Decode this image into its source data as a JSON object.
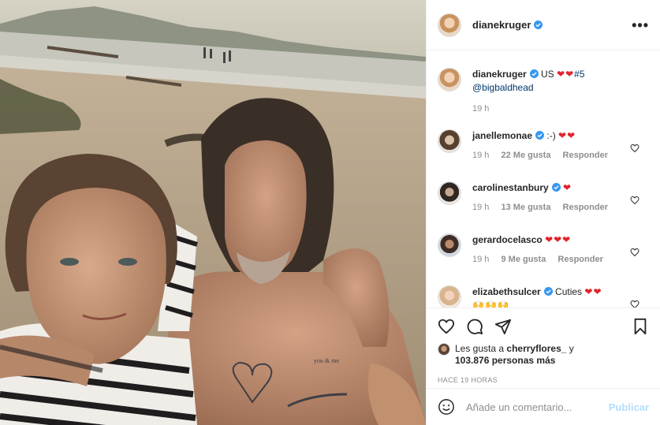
{
  "post": {
    "author": "dianekruger",
    "more_label": "•••",
    "icons": {
      "more": "more-options-icon",
      "verified": "verified-badge-icon"
    }
  },
  "caption": {
    "author": "dianekruger",
    "text": "US",
    "emoji": "❤❤",
    "hashtag": "#5",
    "mention": "@bigbaldhead",
    "time": "19 h"
  },
  "comments": [
    {
      "user": "janellemonae",
      "text": ":-)",
      "emoji": "❤❤",
      "time": "19 h",
      "likes": "22 Me gusta",
      "reply": "Responder"
    },
    {
      "user": "carolinestanbury",
      "text": "",
      "emoji": "❤",
      "time": "19 h",
      "likes": "13 Me gusta",
      "reply": "Responder"
    },
    {
      "user": "gerardocelasco",
      "text": "",
      "emoji": "❤❤❤",
      "time": "19 h",
      "likes": "9 Me gusta",
      "reply": "Responder"
    },
    {
      "user": "elizabethsulcer",
      "text": "Cuties",
      "emoji": "❤❤",
      "extra": "🙌🙌🙌"
    }
  ],
  "likes": {
    "prefix": "Les gusta a",
    "user": "cherryflores_",
    "suffix": "y",
    "count": "103.876 personas más"
  },
  "time_ago": "HACE 19 HORAS",
  "add_comment": {
    "placeholder": "Añade un comentario...",
    "post": "Publicar"
  },
  "colors": {
    "heart": "#e0242c",
    "verified": "#3897f0",
    "post_disabled": "#b2dffc"
  }
}
